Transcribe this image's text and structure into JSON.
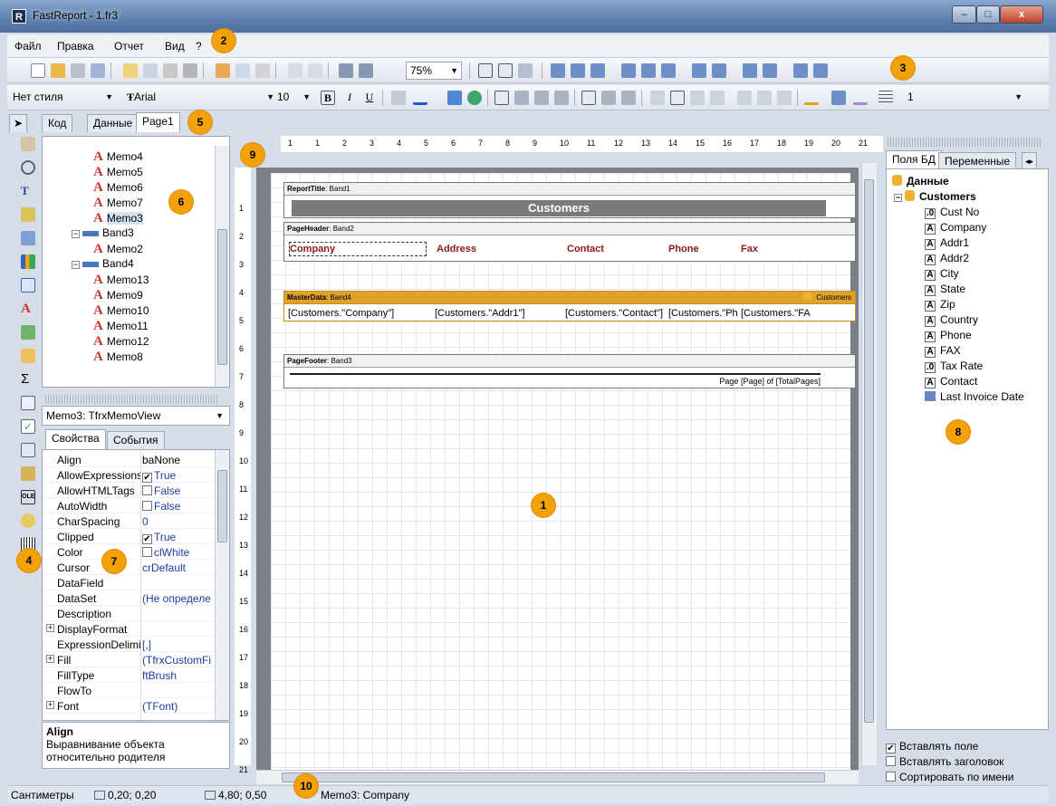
{
  "window": {
    "title": "FastReport - 1.fr3",
    "app_icon": "R",
    "min": "–",
    "max": "□",
    "close": "x"
  },
  "menu": [
    "Файл",
    "Правка",
    "Отчет",
    "Вид",
    "?"
  ],
  "toolbar": {
    "zoom": "75%",
    "style": "Нет стиля",
    "font": "Arial",
    "size": "10",
    "bold": "B",
    "italic": "I",
    "underline": "U",
    "frame_width": "1"
  },
  "tabs": [
    "Код",
    "Данные",
    "Page1"
  ],
  "tree": [
    "Memo4",
    "Memo5",
    "Memo6",
    "Memo7",
    "Memo3",
    "Band3",
    "Memo2",
    "Band4",
    "Memo13",
    "Memo9",
    "Memo10",
    "Memo11",
    "Memo12",
    "Memo8"
  ],
  "object_inspector": {
    "selected": "Memo3: TfrxMemoView",
    "tabs": [
      "Свойства",
      "События"
    ],
    "props": [
      {
        "name": "Align",
        "value": "baNone"
      },
      {
        "name": "AllowExpressions",
        "value": "True",
        "check": "✔"
      },
      {
        "name": "AllowHTMLTags",
        "value": "False",
        "check": ""
      },
      {
        "name": "AutoWidth",
        "value": "False",
        "check": ""
      },
      {
        "name": "CharSpacing",
        "value": "0"
      },
      {
        "name": "Clipped",
        "value": "True",
        "check": "✔"
      },
      {
        "name": "Color",
        "value": "clWhite",
        "check": ""
      },
      {
        "name": "Cursor",
        "value": "crDefault"
      },
      {
        "name": "DataField",
        "value": ""
      },
      {
        "name": "DataSet",
        "value": "(Не определе"
      },
      {
        "name": "Description",
        "value": ""
      },
      {
        "name": "DisplayFormat",
        "value": ""
      },
      {
        "name": "ExpressionDelimit",
        "value": "[,]"
      },
      {
        "name": "Fill",
        "value": "(TfrxCustomFi"
      },
      {
        "name": "FillType",
        "value": "ftBrush"
      },
      {
        "name": "FlowTo",
        "value": ""
      },
      {
        "name": "Font",
        "value": "(TFont)"
      }
    ],
    "desc_title": "Align",
    "desc_text": "Выравнивание объекта относительно родителя"
  },
  "report": {
    "report_title": {
      "label": "ReportTitle",
      "name": "Band1",
      "text": "Customers"
    },
    "page_header": {
      "label": "PageHeader",
      "name": "Band2",
      "cols": [
        "Company",
        "Address",
        "Contact",
        "Phone",
        "Fax"
      ]
    },
    "master_data": {
      "label": "MasterData",
      "name": "Band4",
      "dataset": "Customers",
      "cols": [
        "[Customers.\"Company\"]",
        "[Customers.\"Addr1\"]",
        "[Customers.\"Contact\"]",
        "[Customers.\"Ph",
        "[Customers.\"FA"
      ]
    },
    "page_footer": {
      "label": "PageFooter",
      "name": "Band3",
      "text": "Page [Page] of [TotalPages]"
    }
  },
  "ruler_top": [
    "1",
    "1",
    "2",
    "3",
    "4",
    "5",
    "6",
    "7",
    "8",
    "9",
    "10",
    "11",
    "12",
    "13",
    "14",
    "15",
    "16",
    "17",
    "18",
    "19",
    "20",
    "21"
  ],
  "ruler_left": [
    "1",
    "2",
    "3",
    "4",
    "5",
    "6",
    "7",
    "8",
    "9",
    "10",
    "11",
    "12",
    "13",
    "14",
    "15",
    "16",
    "17",
    "18",
    "19",
    "20",
    "21"
  ],
  "data_panel": {
    "tabs": [
      "Поля БД",
      "Переменные"
    ],
    "root": "Данные",
    "dataset": "Customers",
    "fields": [
      {
        "name": "Cust No",
        "icon": ".0"
      },
      {
        "name": "Company",
        "icon": "A"
      },
      {
        "name": "Addr1",
        "icon": "A"
      },
      {
        "name": "Addr2",
        "icon": "A"
      },
      {
        "name": "City",
        "icon": "A"
      },
      {
        "name": "State",
        "icon": "A"
      },
      {
        "name": "Zip",
        "icon": "A"
      },
      {
        "name": "Country",
        "icon": "A"
      },
      {
        "name": "Phone",
        "icon": "A"
      },
      {
        "name": "FAX",
        "icon": "A"
      },
      {
        "name": "Tax Rate",
        "icon": ".0"
      },
      {
        "name": "Contact",
        "icon": "A"
      },
      {
        "name": "Last Invoice Date",
        "icon": "date"
      }
    ],
    "options": [
      {
        "label": "Вставлять поле",
        "checked": "✔"
      },
      {
        "label": "Вставлять заголовок",
        "checked": ""
      },
      {
        "label": "Сортировать по имени",
        "checked": ""
      }
    ]
  },
  "status": {
    "units": "Сантиметры",
    "pos": "0,20; 0,20",
    "size": "4,80; 0,50",
    "object": "Memo3: Company"
  },
  "badges": [
    "1",
    "2",
    "3",
    "4",
    "5",
    "6",
    "7",
    "8",
    "9",
    "10"
  ],
  "colors": {
    "accent": "#f2a10b",
    "master_band": "#e0a22a",
    "title_band": "#7a7a7a"
  }
}
